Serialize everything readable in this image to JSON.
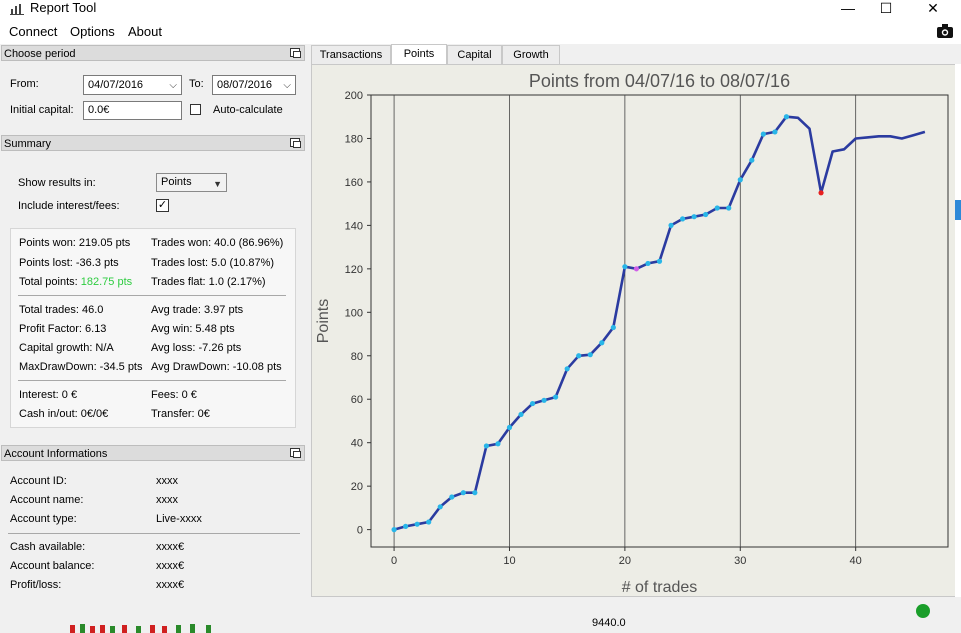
{
  "window": {
    "title": "Report Tool",
    "minimize_glyph": "—",
    "maximize_glyph": "☐",
    "close_glyph": "✕"
  },
  "menu": {
    "items": [
      "Connect",
      "Options",
      "About"
    ]
  },
  "period": {
    "header": "Choose period",
    "from_label": "From:",
    "from_value": "04/07/2016",
    "to_label": "To:",
    "to_value": "08/07/2016",
    "capital_label": "Initial capital:",
    "capital_value": "0.0€",
    "autocalc_label": "Auto-calculate"
  },
  "summary": {
    "header": "Summary",
    "show_results_label": "Show results in:",
    "show_results_value": "Points",
    "include_label": "Include interest/fees:",
    "include_checked": true,
    "points_won": "Points won: 219.05 pts",
    "points_lost": "Points lost: -36.3 pts",
    "total_points_label": "Total points:",
    "total_points_value": "182.75 pts",
    "trades_won": "Trades won: 40.0 (86.96%)",
    "trades_lost": "Trades lost: 5.0 (10.87%)",
    "trades_flat": "Trades flat: 1.0 (2.17%)",
    "total_trades": "Total trades: 46.0",
    "profit_factor": "Profit Factor: 6.13",
    "capital_growth": "Capital growth: N/A",
    "max_drawdown": "MaxDrawDown: -34.5 pts",
    "avg_trade": "Avg trade: 3.97 pts",
    "avg_win": "Avg win: 5.48 pts",
    "avg_loss": "Avg loss: -7.26 pts",
    "avg_drawdown": "Avg DrawDown: -10.08 pts",
    "interest": "Interest: 0 €",
    "cash_inout": "Cash in/out: 0€/0€",
    "fees": "Fees: 0 €",
    "transfer": "Transfer: 0€",
    "accent_green": "#2ecc40"
  },
  "account": {
    "header": "Account Informations",
    "rows": [
      {
        "label": "Account ID:",
        "value": "xxxx"
      },
      {
        "label": "Account name:",
        "value": "xxxx"
      },
      {
        "label": "Account type:",
        "value": "Live-xxxx"
      },
      {
        "label": "Cash available:",
        "value": "xxxx€"
      },
      {
        "label": "Account balance:",
        "value": "xxxx€"
      },
      {
        "label": "Profit/loss:",
        "value": "xxxx€"
      }
    ]
  },
  "tabs": [
    "Transactions",
    "Points",
    "Capital",
    "Growth"
  ],
  "active_tab": "Points",
  "chart_data": {
    "type": "line",
    "title": "Points from 04/07/16 to 08/07/16",
    "xlabel": "# of trades",
    "ylabel": "Points",
    "xlim": [
      -2,
      48
    ],
    "ylim": [
      -8,
      200
    ],
    "xticks": [
      0,
      10,
      20,
      30,
      40
    ],
    "yticks": [
      0,
      20,
      40,
      60,
      80,
      100,
      120,
      140,
      160,
      180,
      200
    ],
    "x_gridlines": [
      0,
      10,
      20,
      30,
      40
    ],
    "line_color": "#2b3ba0",
    "marker_win_color": "#29b6e8",
    "marker_loss_color": "#e8201f",
    "marker_flat_color": "#d060e8",
    "series": [
      {
        "x": [
          0,
          1,
          2,
          3,
          4,
          5,
          6,
          7,
          8,
          9,
          10,
          11,
          12,
          13,
          14,
          15,
          16,
          17,
          18,
          19,
          20,
          21,
          22,
          23,
          24,
          25,
          26,
          27,
          28,
          29,
          30,
          31,
          32,
          33,
          34,
          35,
          36,
          37,
          38,
          39,
          40,
          41,
          42,
          43,
          44,
          45,
          46
        ],
        "y": [
          0,
          1.5,
          2.5,
          3.5,
          10.5,
          15,
          17,
          17,
          38.5,
          39.5,
          47,
          53,
          58,
          59.5,
          61,
          74,
          80,
          80.5,
          86,
          93,
          121,
          120,
          122.5,
          123.5,
          140,
          143,
          144,
          145,
          148,
          148,
          161,
          170,
          182,
          183,
          190,
          189.5,
          184.5,
          155,
          174,
          175,
          180,
          180.5,
          181,
          181,
          180,
          181.5,
          183
        ],
        "markers": [
          "win",
          "win",
          "win",
          "win",
          "win",
          "win",
          "win",
          "win",
          "win",
          "win",
          "win",
          "win",
          "win",
          "win",
          "win",
          "win",
          "win",
          "win",
          "win",
          "win",
          "win",
          "flat",
          "win",
          "win",
          "win",
          "win",
          "win",
          "win",
          "win",
          "win",
          "win",
          "win",
          "win",
          "win",
          "win",
          "none",
          "none",
          "loss",
          "none",
          "none",
          "none",
          "none",
          "none",
          "none",
          "none",
          "none",
          "none"
        ]
      }
    ]
  },
  "background_price_label": "9440.0"
}
